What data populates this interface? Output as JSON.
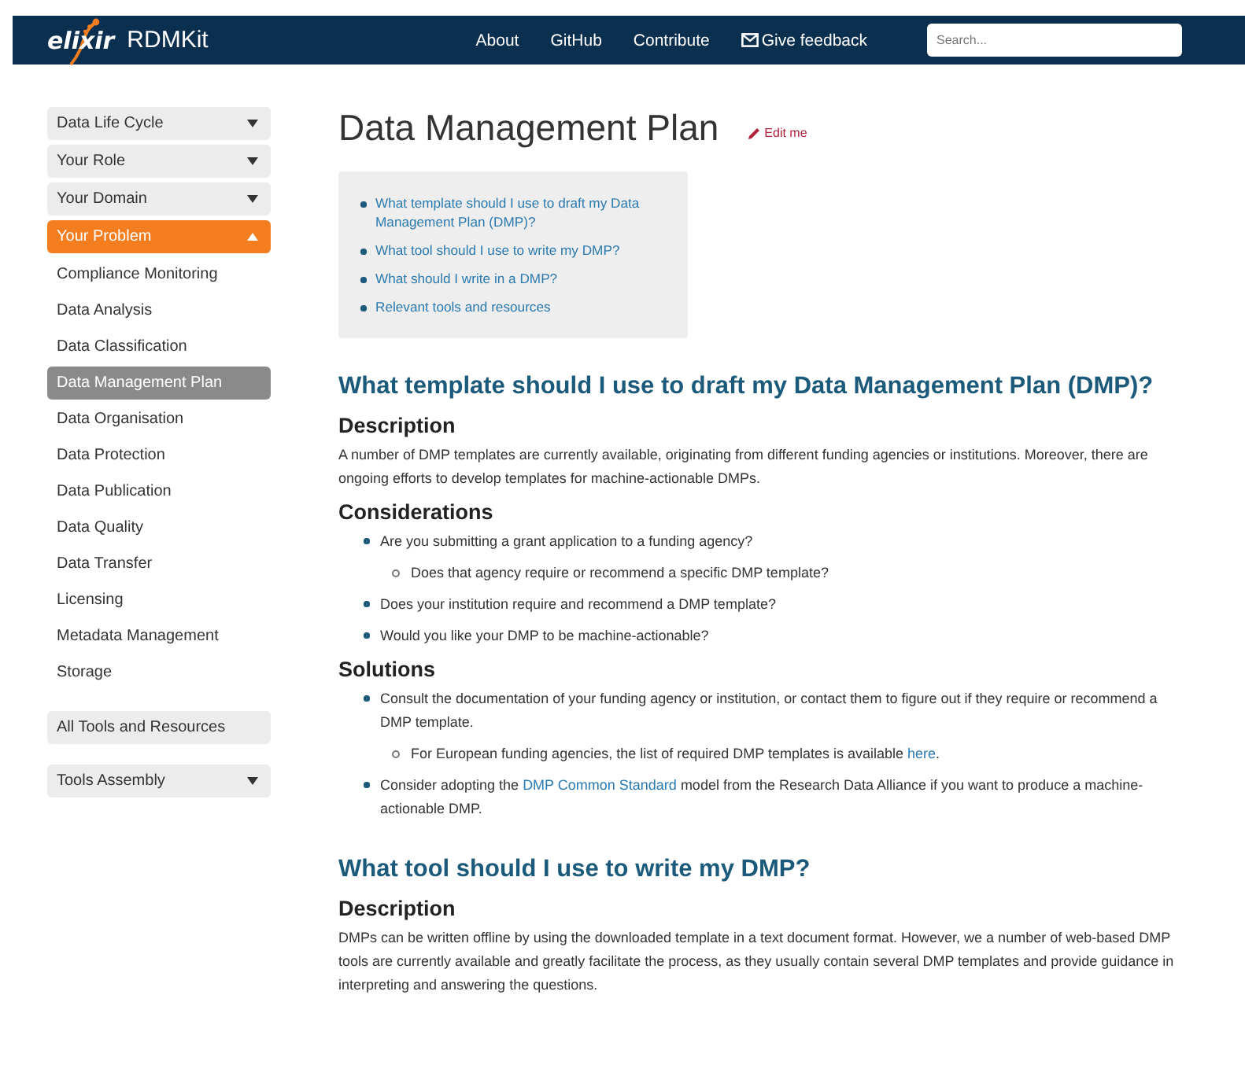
{
  "header": {
    "logo_text": "elixir",
    "site_title": "RDMKit",
    "nav": [
      {
        "label": "About",
        "kind": "plain"
      },
      {
        "label": "GitHub",
        "kind": "plain"
      },
      {
        "label": "Contribute",
        "kind": "plain"
      },
      {
        "label": "Give feedback",
        "kind": "mail"
      }
    ],
    "search": {
      "placeholder": "Search..."
    }
  },
  "sidebar": {
    "items": [
      {
        "label": "Data Life Cycle",
        "kind": "menu",
        "expanded": false
      },
      {
        "label": "Your Role",
        "kind": "menu",
        "expanded": false
      },
      {
        "label": "Your Domain",
        "kind": "menu",
        "expanded": false
      },
      {
        "label": "Your Problem",
        "kind": "menu",
        "expanded": true,
        "children": [
          {
            "label": "Compliance Monitoring",
            "selected": false
          },
          {
            "label": "Data Analysis",
            "selected": false
          },
          {
            "label": "Data Classification",
            "selected": false
          },
          {
            "label": "Data Management Plan",
            "selected": true
          },
          {
            "label": "Data Organisation",
            "selected": false
          },
          {
            "label": "Data Protection",
            "selected": false
          },
          {
            "label": "Data Publication",
            "selected": false
          },
          {
            "label": "Data Quality",
            "selected": false
          },
          {
            "label": "Data Transfer",
            "selected": false
          },
          {
            "label": "Licensing",
            "selected": false
          },
          {
            "label": "Metadata Management",
            "selected": false
          },
          {
            "label": "Storage",
            "selected": false
          }
        ]
      },
      {
        "label": "All Tools and Resources",
        "kind": "link"
      },
      {
        "label": "Tools Assembly",
        "kind": "menu",
        "expanded": false
      }
    ]
  },
  "page": {
    "title": "Data Management Plan",
    "edit_link": "Edit me",
    "toc": [
      "What template should I use to draft my Data Management Plan (DMP)?",
      "What tool should I use to write my DMP?",
      "What should I write in a DMP?",
      "Relevant tools and resources"
    ],
    "blocks": [
      {
        "kind": "h2",
        "text": "What template should I use to draft my Data Management Plan (DMP)?"
      },
      {
        "kind": "h3",
        "text": "Description"
      },
      {
        "kind": "p",
        "parts": [
          {
            "kind": "text",
            "text": "A number of DMP templates are currently available, originating from different funding agencies or institutions. Moreover, there are ongoing efforts to develop templates for machine-actionable DMPs."
          }
        ]
      },
      {
        "kind": "h3",
        "text": "Considerations"
      },
      {
        "kind": "list",
        "items": [
          {
            "parts": [
              {
                "kind": "text",
                "text": "Are you submitting a grant application to a funding agency?"
              }
            ],
            "children": [
              {
                "parts": [
                  {
                    "kind": "text",
                    "text": "Does that agency require or recommend a specific DMP template?"
                  }
                ]
              }
            ]
          },
          {
            "parts": [
              {
                "kind": "text",
                "text": "Does your institution require and recommend a DMP template?"
              }
            ]
          },
          {
            "parts": [
              {
                "kind": "text",
                "text": "Would you like your DMP to be machine-actionable?"
              }
            ]
          }
        ]
      },
      {
        "kind": "h3",
        "text": "Solutions"
      },
      {
        "kind": "list",
        "items": [
          {
            "parts": [
              {
                "kind": "text",
                "text": "Consult the documentation of your funding agency or institution, or contact them to figure out if they require or recommend a DMP template."
              }
            ],
            "children": [
              {
                "parts": [
                  {
                    "kind": "text",
                    "text": "For European funding agencies, the list of required DMP templates is available "
                  },
                  {
                    "kind": "link",
                    "text": "here"
                  },
                  {
                    "kind": "text",
                    "text": "."
                  }
                ]
              }
            ]
          },
          {
            "parts": [
              {
                "kind": "text",
                "text": "Consider adopting the "
              },
              {
                "kind": "link",
                "text": "DMP Common Standard"
              },
              {
                "kind": "text",
                "text": " model from the Research Data Alliance if you want to produce a machine-actionable DMP."
              }
            ]
          }
        ]
      },
      {
        "kind": "h2",
        "text": "What tool should I use to write my DMP?"
      },
      {
        "kind": "h3",
        "text": "Description"
      },
      {
        "kind": "p",
        "parts": [
          {
            "kind": "text",
            "text": "DMPs can be written offline by using the downloaded template in a text document format. However, we a number of web-based DMP tools are currently available and greatly facilitate the process, as they usually contain several DMP templates and provide guidance in interpreting and answering the questions."
          }
        ]
      }
    ]
  }
}
